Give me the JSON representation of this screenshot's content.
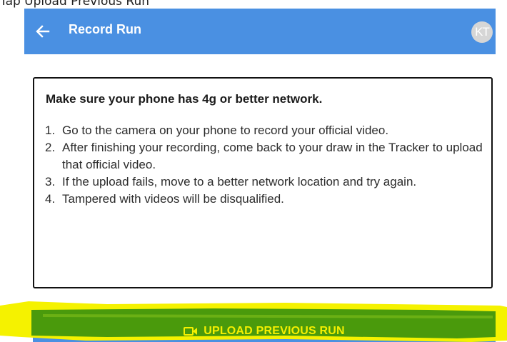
{
  "caption": "Tap Upload Previous Run",
  "appbar": {
    "title": "Record Run",
    "avatar_initials": "KT",
    "color": "#4a90e2"
  },
  "instructions": {
    "heading": "Make sure your phone has 4g or better network.",
    "items": [
      {
        "num": "1.",
        "text": "Go to the camera on your phone to record your official video."
      },
      {
        "num": "2.",
        "text": "After finishing your recording, come back to your draw in the Tracker to upload that official video."
      },
      {
        "num": "3.",
        "text": "If the upload fails, move to a better network location and try again."
      },
      {
        "num": "4.",
        "text": "Tampered with videos will be disqualified."
      }
    ]
  },
  "upload_button": {
    "label": "UPLOAD PREVIOUS RUN",
    "icon": "video-camera-icon"
  },
  "highlight_colors": {
    "yellow": "#f5f200",
    "green": "#4a9a0c"
  }
}
